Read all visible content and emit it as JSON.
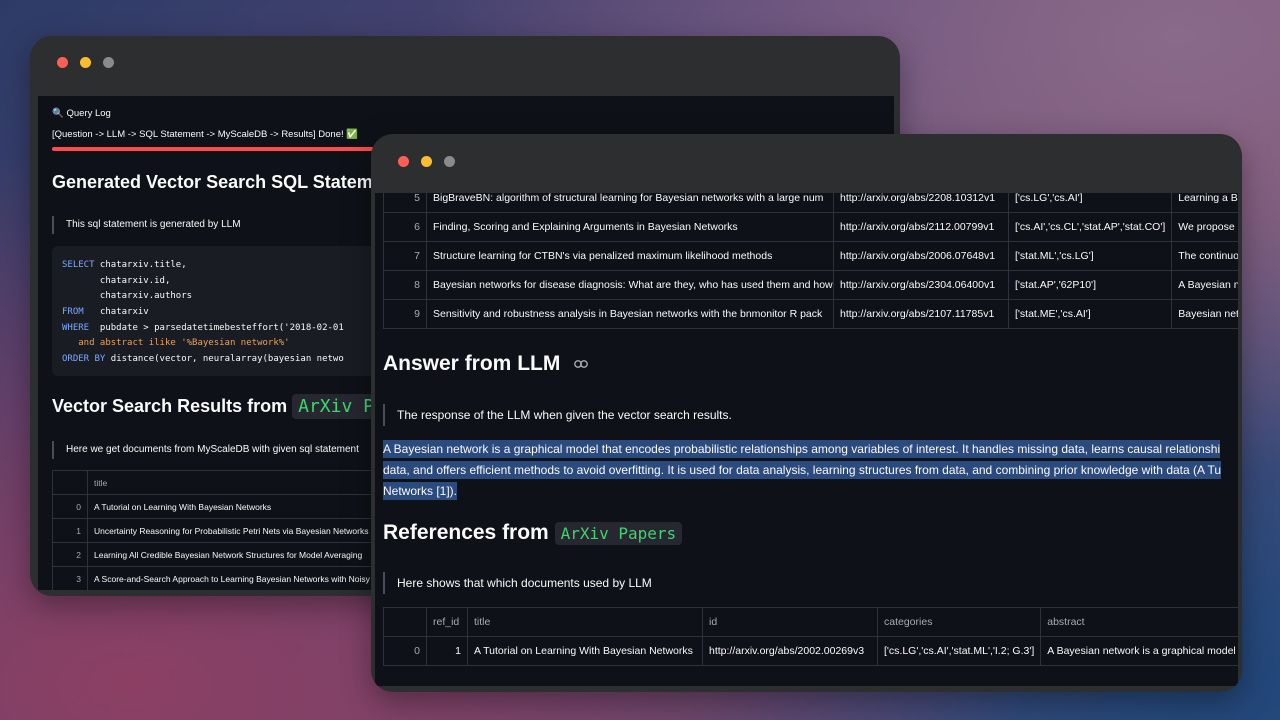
{
  "back_window": {
    "query_log": "🔍 Query Log",
    "status": "[Question -> LLM -> SQL Statement -> MyScaleDB -> Results] Done! ✅",
    "progress": 1.0,
    "sql_heading": "Generated Vector Search SQL Statement",
    "sql_caption": "This sql statement is generated by LLM",
    "sql_lines": [
      {
        "kw": "SELECT",
        "rest": " chatarxiv.title,"
      },
      {
        "kw": "",
        "rest": "       chatarxiv.id,"
      },
      {
        "kw": "",
        "rest": "       chatarxiv.authors"
      },
      {
        "kw": "FROM",
        "rest": "   chatarxiv"
      },
      {
        "kw": "WHERE",
        "rest": "  pubdate > parsedatetimebesteffort('2018-02-01"
      },
      {
        "kw": "",
        "rest": "   and abstract ilike '%Bayesian network%'"
      },
      {
        "kw": "ORDER BY",
        "rest": " distance(vector, neuralarray(bayesian netwo"
      }
    ],
    "results_heading": "Vector Search Results from",
    "results_chip": "ArXiv Papers",
    "results_caption": "Here we get documents from MyScaleDB with given sql statement",
    "table_header": [
      "",
      "title"
    ],
    "rows": [
      {
        "i": "0",
        "title": "A Tutorial on Learning With Bayesian Networks"
      },
      {
        "i": "1",
        "title": "Uncertainty Reasoning for Probabilistic Petri Nets via Bayesian Networks"
      },
      {
        "i": "2",
        "title": "Learning All Credible Bayesian Network Structures for Model Averaging"
      },
      {
        "i": "3",
        "title": "A Score-and-Search Approach to Learning Bayesian Networks with Noisy"
      }
    ]
  },
  "front_window": {
    "top_rows": [
      {
        "i": "5",
        "title": "BigBraveBN: algorithm of structural learning for Bayesian networks with a large num",
        "id": "http://arxiv.org/abs/2208.10312v1",
        "cats": "['cs.LG','cs.AI']",
        "abs": "Learning a Ba"
      },
      {
        "i": "6",
        "title": "Finding, Scoring and Explaining Arguments in Bayesian Networks",
        "id": "http://arxiv.org/abs/2112.00799v1",
        "cats": "['cs.AI','cs.CL','stat.AP','stat.CO']",
        "abs": "We propose a"
      },
      {
        "i": "7",
        "title": "Structure learning for CTBN's via penalized maximum likelihood methods",
        "id": "http://arxiv.org/abs/2006.07648v1",
        "cats": "['stat.ML','cs.LG']",
        "abs": "The continuo"
      },
      {
        "i": "8",
        "title": "Bayesian networks for disease diagnosis: What are they, who has used  them and how",
        "id": "http://arxiv.org/abs/2304.06400v1",
        "cats": "['stat.AP','62P10']",
        "abs": "A Bayesian ne"
      },
      {
        "i": "9",
        "title": "Sensitivity and robustness analysis in Bayesian networks with the  bnmonitor R pack",
        "id": "http://arxiv.org/abs/2107.11785v1",
        "cats": "['stat.ME','cs.AI']",
        "abs": "Bayesian netw"
      }
    ],
    "answer_heading": "Answer from LLM",
    "answer_caption": "The response of the LLM when given the vector search results.",
    "answer_lines": [
      "A Bayesian network is a graphical model that encodes probabilistic relationships among variables of interest. It handles missing data, learns causal relationshi",
      "data, and offers efficient methods to avoid overfitting. It is used for data analysis, learning structures from data, and combining prior knowledge with data (A Tu",
      "Networks [1])."
    ],
    "refs_heading": "References from",
    "refs_chip": "ArXiv Papers",
    "refs_caption": "Here shows that which documents used by LLM",
    "ref_header": [
      "",
      "ref_id",
      "title",
      "id",
      "categories",
      "abstract"
    ],
    "ref_rows": [
      {
        "i": "0",
        "ref": "1",
        "title": "A Tutorial on Learning With Bayesian Networks",
        "id": "http://arxiv.org/abs/2002.00269v3",
        "cats": "['cs.LG','cs.AI','stat.ML','I.2; G.3']",
        "abs": "A Bayesian network is a graphical model t"
      }
    ]
  }
}
